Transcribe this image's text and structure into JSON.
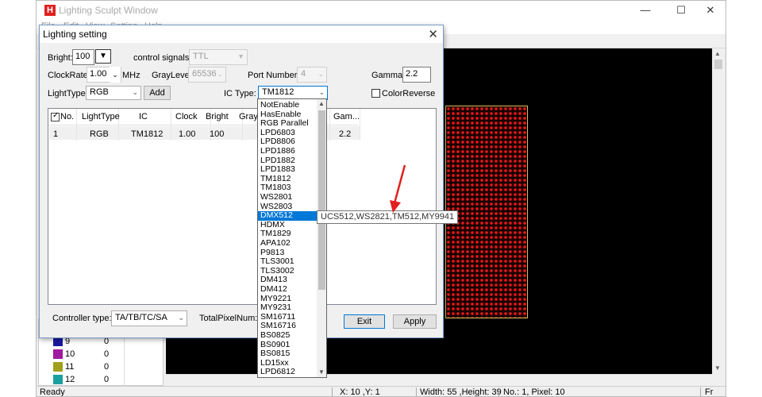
{
  "window": {
    "title": "Lighting Sculpt Window",
    "logo_letter": "H",
    "min_glyph": "—",
    "max_glyph": "☐",
    "close_glyph": "✕",
    "menu": [
      "File",
      "Edit",
      "View",
      "Setting",
      "Help"
    ]
  },
  "dialog": {
    "title": "Lighting setting",
    "close_glyph": "✕",
    "bright_label": "Bright:",
    "bright_value": "100",
    "control_signals_label": "control signals:",
    "control_signals_value": "TTL",
    "clockrate_label": "ClockRate:",
    "clockrate_value": "1.00",
    "clockrate_unit": "MHz",
    "graylevel_label": "GrayLevel:",
    "graylevel_value": "65536",
    "port_number_label": "Port Number:",
    "port_number_value": "4",
    "gamma_label": "Gamma:",
    "gamma_value": "2.2",
    "lighttype_label": "LightType:",
    "lighttype_value": "RGB",
    "add_label": "Add",
    "ictype_label": "IC Type:",
    "ictype_value": "TM1812",
    "colorreverse_label": "ColorReverse",
    "controller_type_label": "Controller type:",
    "controller_type_value": "TA/TB/TC/SA",
    "total_pixel_label": "TotalPixelNum:",
    "exit_label": "Exit",
    "apply_label": "Apply"
  },
  "grid": {
    "headers": [
      "No.",
      "LightType",
      "IC",
      "Clock",
      "Bright",
      "Gray",
      "Gam..."
    ],
    "row": {
      "no": "1",
      "lighttype": "RGB",
      "ic": "TM1812",
      "clock": "1.00",
      "bright": "100",
      "gamma": "2.2"
    }
  },
  "ic_dropdown": {
    "options": [
      "NotEnable",
      "HasEnable",
      "RGB Parallel",
      "LPD6803",
      "LPD8806",
      "LPD1886",
      "LPD1882",
      "LPD1883",
      "TM1812",
      "TM1803",
      "WS2801",
      "WS2803",
      "DMX512",
      "HDMX",
      "TM1829",
      "APA102",
      "P9813",
      "TLS3001",
      "TLS3002",
      "DM413",
      "DM412",
      "MY9221",
      "MY9231",
      "SM16711",
      "SM16716",
      "BS0825",
      "BS0901",
      "BS0815",
      "LD15xx",
      "LPD6812"
    ],
    "selected": "DMX512",
    "tooltip": "UCS512,WS2821,TM512,MY9941"
  },
  "color_list": [
    {
      "num": "9",
      "val": "0",
      "color": "#1a1aa0"
    },
    {
      "num": "10",
      "val": "0",
      "color": "#a01aa0"
    },
    {
      "num": "11",
      "val": "0",
      "color": "#a0a01a"
    },
    {
      "num": "12",
      "val": "0",
      "color": "#1aa0a0"
    }
  ],
  "status": {
    "ready": "Ready",
    "coords": "X: 10 ,Y: 1",
    "size": "Width: 55 ,Height: 39",
    "pixel": "No.: 1, Pixel: 10",
    "extra": "Fr"
  },
  "colors": {
    "selection": "#0078d7",
    "led": "#e01818",
    "annotation_arrow": "#e02020"
  }
}
